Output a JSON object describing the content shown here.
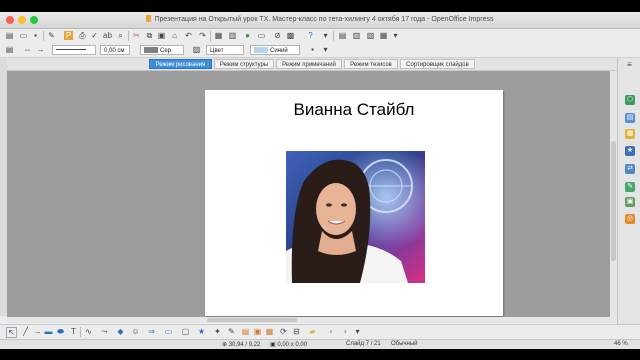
{
  "window": {
    "title": "Презентация на Открытый урок TX. Мастер-класс по тета-хилингу 4 октябя 17 года - OpenOffice Impress"
  },
  "format_bar": {
    "line_width": "0,00 cм",
    "line_color": "Сер",
    "area_style": "Цвет",
    "area_color": "Синий"
  },
  "view_tabs": [
    {
      "label": "Режим рисования",
      "active": true
    },
    {
      "label": "Режим структуры",
      "active": false
    },
    {
      "label": "Режим примечаний",
      "active": false
    },
    {
      "label": "Режим тезисов",
      "active": false
    },
    {
      "label": "Сортировщик слайдов",
      "active": false
    }
  ],
  "slide": {
    "title": "Вианна  Стайбл"
  },
  "status": {
    "position": "30,94 / 9,22",
    "size": "0,00 x 0,00",
    "slide": "Слайд 7 / 21",
    "layout": "Обычный",
    "zoom": "46 %"
  },
  "colors": {
    "accent": "#3c8fd8",
    "canvas": "#9d9d9d"
  }
}
